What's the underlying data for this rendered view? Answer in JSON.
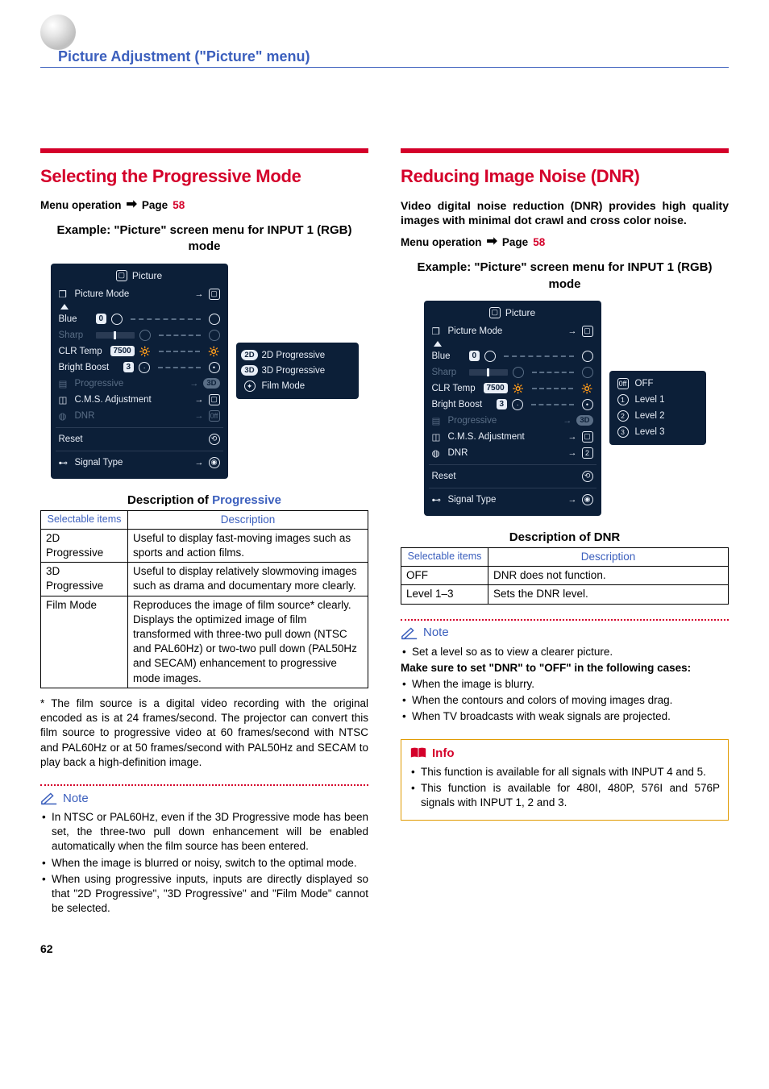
{
  "page": {
    "title": "Picture Adjustment (\"Picture\" menu)",
    "number": "62"
  },
  "left": {
    "heading": "Selecting the Progressive Mode",
    "menu_op_prefix": "Menu operation",
    "menu_op_page_label": "Page",
    "menu_op_page": "58",
    "example_title": "Example: \"Picture\" screen menu for INPUT 1 (RGB) mode",
    "osd": {
      "title": "Picture",
      "picture_mode": "Picture Mode",
      "blue": "Blue",
      "blue_val": "0",
      "sharp": "Sharp",
      "clr_temp": "CLR Temp",
      "clr_temp_val": "7500",
      "bright_boost": "Bright Boost",
      "bright_boost_val": "3",
      "progressive": "Progressive",
      "cms": "C.M.S. Adjustment",
      "dnr": "DNR",
      "reset": "Reset",
      "signal_type": "Signal Type",
      "prog_badge": "3D",
      "dnr_badge": "0ff"
    },
    "options": {
      "a_badge": "2D",
      "a_label": "2D Progressive",
      "b_badge": "3D",
      "b_label": "3D Progressive",
      "c_label": "Film Mode"
    },
    "table": {
      "caption_plain": "Description of ",
      "caption_hl": "Progressive",
      "h1": "Selectable items",
      "h2": "Description",
      "rows": [
        {
          "k": "2D\nProgressive",
          "v": "Useful to display fast-moving images such as sports and action films."
        },
        {
          "k": "3D\nProgressive",
          "v": "Useful to display relatively slowmoving images such as drama and documentary more clearly."
        },
        {
          "k": "Film Mode",
          "v": "Reproduces the image of film source* clearly. Displays the optimized image of film transformed with three-two pull down (NTSC and PAL60Hz) or two-two pull down (PAL50Hz and SECAM) enhancement to progressive mode images."
        }
      ]
    },
    "footnote": "The film source is a digital video recording with the original encoded as is at 24 frames/second. The projector can convert this film source to progressive video at 60 frames/second with NTSC and PAL60Hz or at 50 frames/second with PAL50Hz and SECAM to play back a high-definition image.",
    "note_label": "Note",
    "notes": [
      "In NTSC or PAL60Hz, even if the 3D Progressive mode has been set, the three-two pull down enhancement will be enabled automatically when the film source has been entered.",
      "When the image is blurred or noisy, switch to the optimal mode.",
      "When using progressive inputs, inputs are directly displayed so that \"2D Progressive\", \"3D Progressive\" and \"Film Mode\" cannot be selected."
    ]
  },
  "right": {
    "heading": "Reducing Image Noise (DNR)",
    "intro": "Video digital noise reduction (DNR) provides high quality images with minimal dot crawl and cross color noise.",
    "menu_op_prefix": "Menu operation",
    "menu_op_page_label": "Page",
    "menu_op_page": "58",
    "example_title": "Example: \"Picture\" screen menu for INPUT 1 (RGB) mode",
    "osd": {
      "title": "Picture",
      "picture_mode": "Picture Mode",
      "blue": "Blue",
      "blue_val": "0",
      "sharp": "Sharp",
      "clr_temp": "CLR Temp",
      "clr_temp_val": "7500",
      "bright_boost": "Bright Boost",
      "bright_boost_val": "3",
      "progressive": "Progressive",
      "cms": "C.M.S. Adjustment",
      "dnr": "DNR",
      "reset": "Reset",
      "signal_type": "Signal Type",
      "prog_badge": "3D",
      "dnr_badge": "2"
    },
    "options": {
      "off": "OFF",
      "l1": "Level 1",
      "l2": "Level 2",
      "l3": "Level 3"
    },
    "table": {
      "caption": "Description of DNR",
      "h1": "Selectable items",
      "h2": "Description",
      "rows": [
        {
          "k": "OFF",
          "v": "DNR does not function."
        },
        {
          "k": "Level 1–3",
          "v": "Sets the DNR level."
        }
      ]
    },
    "note_label": "Note",
    "note_first": "Set a level so as to view a clearer picture.",
    "note_bold": "Make sure to set \"DNR\" to \"OFF\" in the following cases:",
    "note_items": [
      "When the image is blurry.",
      "When the contours and colors of moving images drag.",
      "When TV broadcasts with weak signals are projected."
    ],
    "info_label": "Info",
    "info_items": [
      "This function is available for all signals with INPUT 4 and 5.",
      "This function is available for 480I, 480P, 576I and 576P signals with INPUT 1, 2 and 3."
    ]
  }
}
